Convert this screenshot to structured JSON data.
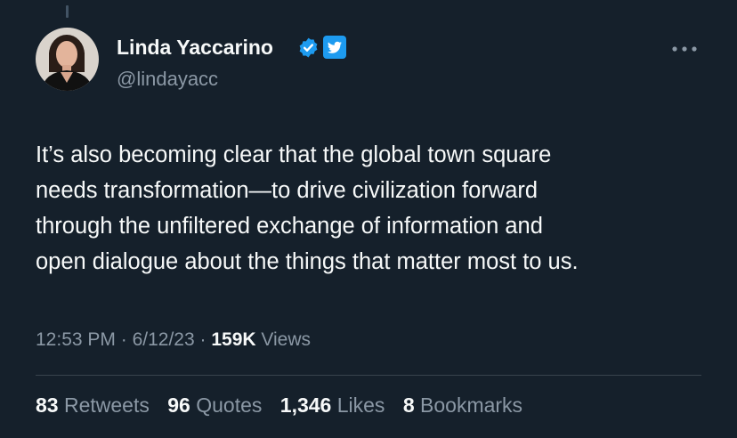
{
  "author": {
    "display_name": "Linda Yaccarino",
    "handle": "@lindayacc",
    "verified": true,
    "badge_icon": "twitter-bird-icon",
    "avatar_icon": "profile-photo"
  },
  "tweet": {
    "lines": [
      "It’s also becoming clear that the global town square",
      "needs transformation—to drive civilization forward",
      "through the unfiltered exchange of information and",
      "open dialogue about the things that matter most to us."
    ]
  },
  "meta": {
    "time": "12:53 PM",
    "date": "6/12/23",
    "separator": "·",
    "views_count": "159K",
    "views_label": "Views"
  },
  "stats": {
    "retweets_count": "83",
    "retweets_label": "Retweets",
    "quotes_count": "96",
    "quotes_label": "Quotes",
    "likes_count": "1,346",
    "likes_label": "Likes",
    "bookmarks_count": "8",
    "bookmarks_label": "Bookmarks"
  },
  "colors": {
    "background": "#15202b",
    "primary_text": "#f7f9f9",
    "secondary_text": "#8b98a5",
    "accent": "#1d9bf0",
    "divider": "#38444d"
  }
}
